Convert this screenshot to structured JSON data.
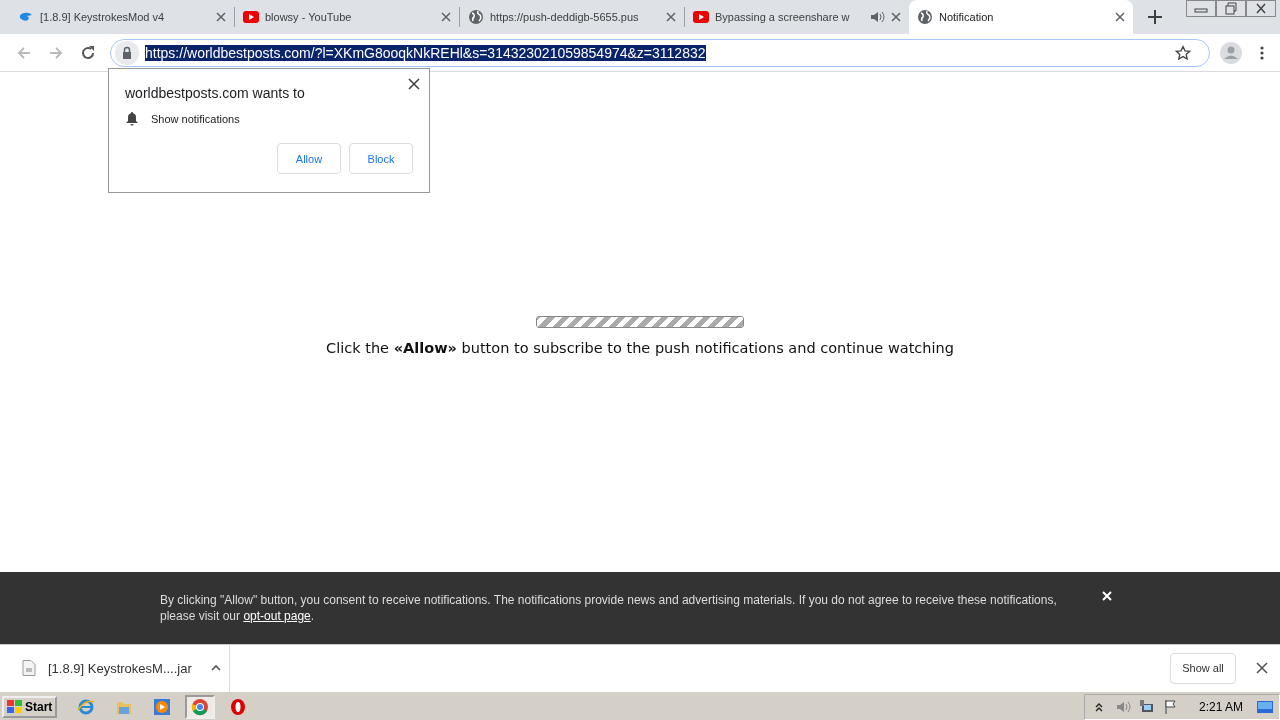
{
  "tabs": [
    {
      "title": "[1.8.9] KeystrokesMod v4",
      "kind": "cloud",
      "audible": false,
      "selected": false
    },
    {
      "title": "blowsy - YouTube",
      "kind": "youtube",
      "audible": false,
      "selected": false
    },
    {
      "title": "https://push-deddigb-5655.pus",
      "kind": "globe",
      "audible": false,
      "selected": false
    },
    {
      "title": "Bypassing a screenshare w",
      "kind": "youtube",
      "audible": true,
      "selected": false
    },
    {
      "title": "Notification",
      "kind": "globe",
      "audible": false,
      "selected": true
    }
  ],
  "address_bar": {
    "value": "https://worldbestposts.com/?l=XKmG8ooqkNkREHl&s=314323021059854974&z=3112832",
    "highlighted": true
  },
  "permission_popup": {
    "title": "worldbestposts.com wants to",
    "permission": "Show notifications",
    "buttons": [
      "Allow",
      "Block"
    ]
  },
  "page": {
    "progress": {
      "level": 1
    },
    "message": "Click the **«Allow»** button to subscribe to the push notifications and continue watching"
  },
  "consent_bar": {
    "text": "By clicking \"Allow\" button, you consent to receive notifications. The notifications provide news and advertising materials. If you do not agree to receive these notifications, please visit our ",
    "link": "opt-out page",
    "text_end": "."
  },
  "download_bar": {
    "file": "[1.8.9] KeystrokesM....jar",
    "show_all": "Show all"
  },
  "taskbar": {
    "start": "Start",
    "apps": [
      {
        "kind": "ie",
        "selected": false
      },
      {
        "kind": "folder",
        "selected": false
      },
      {
        "kind": "media",
        "selected": false
      },
      {
        "kind": "chrome",
        "selected": true
      },
      {
        "kind": "opera",
        "selected": false
      }
    ],
    "clock": "2:21 AM"
  }
}
